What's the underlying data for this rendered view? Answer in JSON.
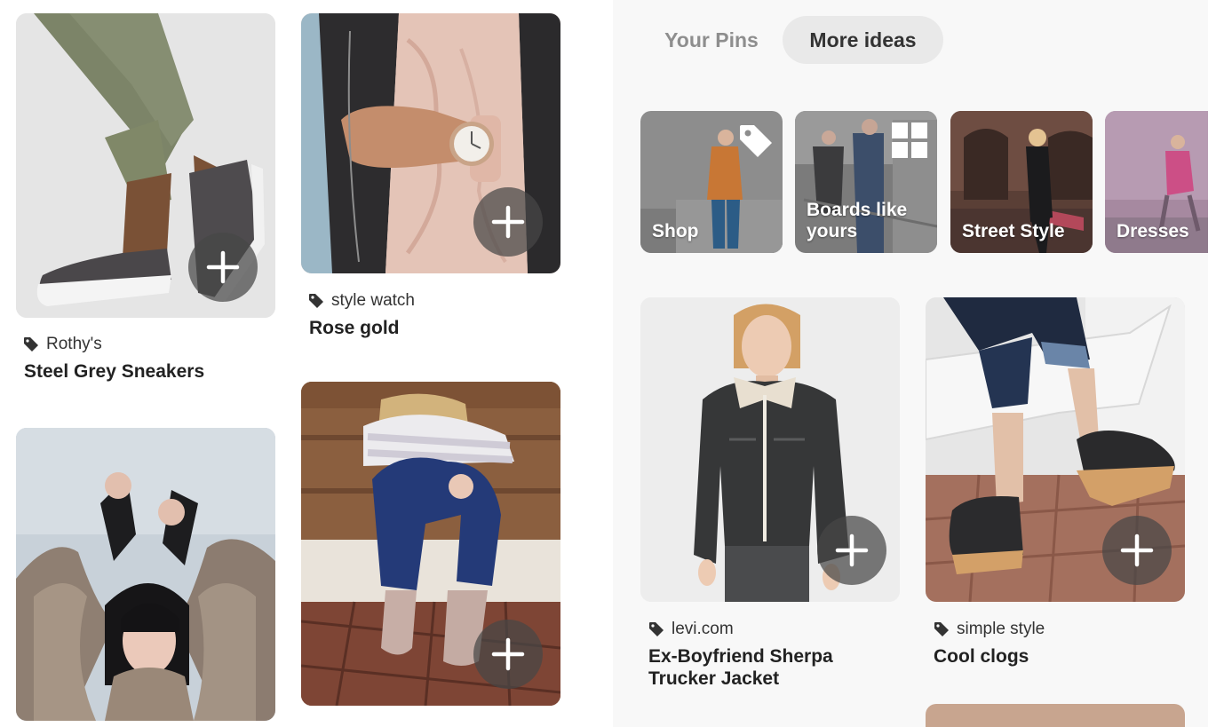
{
  "left_feed": {
    "pins": [
      {
        "source": "Rothy's",
        "title": "Steel Grey Sneakers"
      },
      {
        "source": "style watch",
        "title": "Rose gold"
      }
    ]
  },
  "right_panel": {
    "tabs": [
      {
        "label": "Your Pins",
        "active": false
      },
      {
        "label": "More ideas",
        "active": true
      }
    ],
    "categories": [
      {
        "label": "Shop",
        "icon": "price-tag-icon"
      },
      {
        "label": "Boards like yours",
        "icon": "grid-icon"
      },
      {
        "label": "Street Style",
        "icon": ""
      },
      {
        "label": "Dresses",
        "icon": ""
      }
    ],
    "pins": [
      {
        "source": "levi.com",
        "title": "Ex-Boyfriend Sherpa Trucker Jacket"
      },
      {
        "source": "simple style",
        "title": "Cool clogs"
      }
    ]
  },
  "icons": {
    "save": "plus-icon",
    "source": "tag-icon"
  },
  "colors": {
    "save_button": "#464646",
    "active_tab_bg": "#e9e9e9",
    "inactive_tab_text": "#8e8e8e"
  }
}
